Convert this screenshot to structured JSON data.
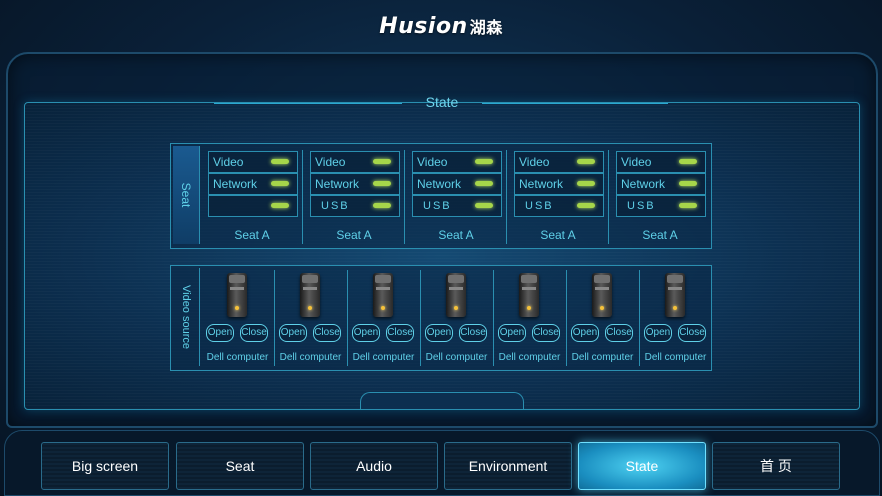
{
  "header": {
    "brand": "Husion",
    "brand_cn": "湖森"
  },
  "page": {
    "title": "State"
  },
  "seat_panel": {
    "side_label": "Seat",
    "seats": [
      {
        "name": "Seat A",
        "rows": [
          "Video",
          "Network",
          ""
        ]
      },
      {
        "name": "Seat A",
        "rows": [
          "Video",
          "Network",
          "USB"
        ]
      },
      {
        "name": "Seat A",
        "rows": [
          "Video",
          "Network",
          "USB"
        ]
      },
      {
        "name": "Seat A",
        "rows": [
          "Video",
          "Network",
          "USB"
        ]
      },
      {
        "name": "Seat A",
        "rows": [
          "Video",
          "Network",
          "USB"
        ]
      }
    ],
    "indicator_color": "#a6d64a"
  },
  "video_panel": {
    "side_label": "Video source",
    "open_label": "Open",
    "close_label": "Close",
    "sources": [
      "Dell computer",
      "Dell computer",
      "Dell computer",
      "Dell computer",
      "Dell computer",
      "Dell computer",
      "Dell computer"
    ]
  },
  "nav": {
    "items": [
      {
        "label": "Big screen"
      },
      {
        "label": "Seat"
      },
      {
        "label": "Audio"
      },
      {
        "label": "Environment"
      },
      {
        "label": "State",
        "active": true
      },
      {
        "label": "首 页"
      }
    ]
  },
  "colors": {
    "accent": "#5fd0e8",
    "active": "#4ed2f2",
    "background": "#0a2038"
  }
}
